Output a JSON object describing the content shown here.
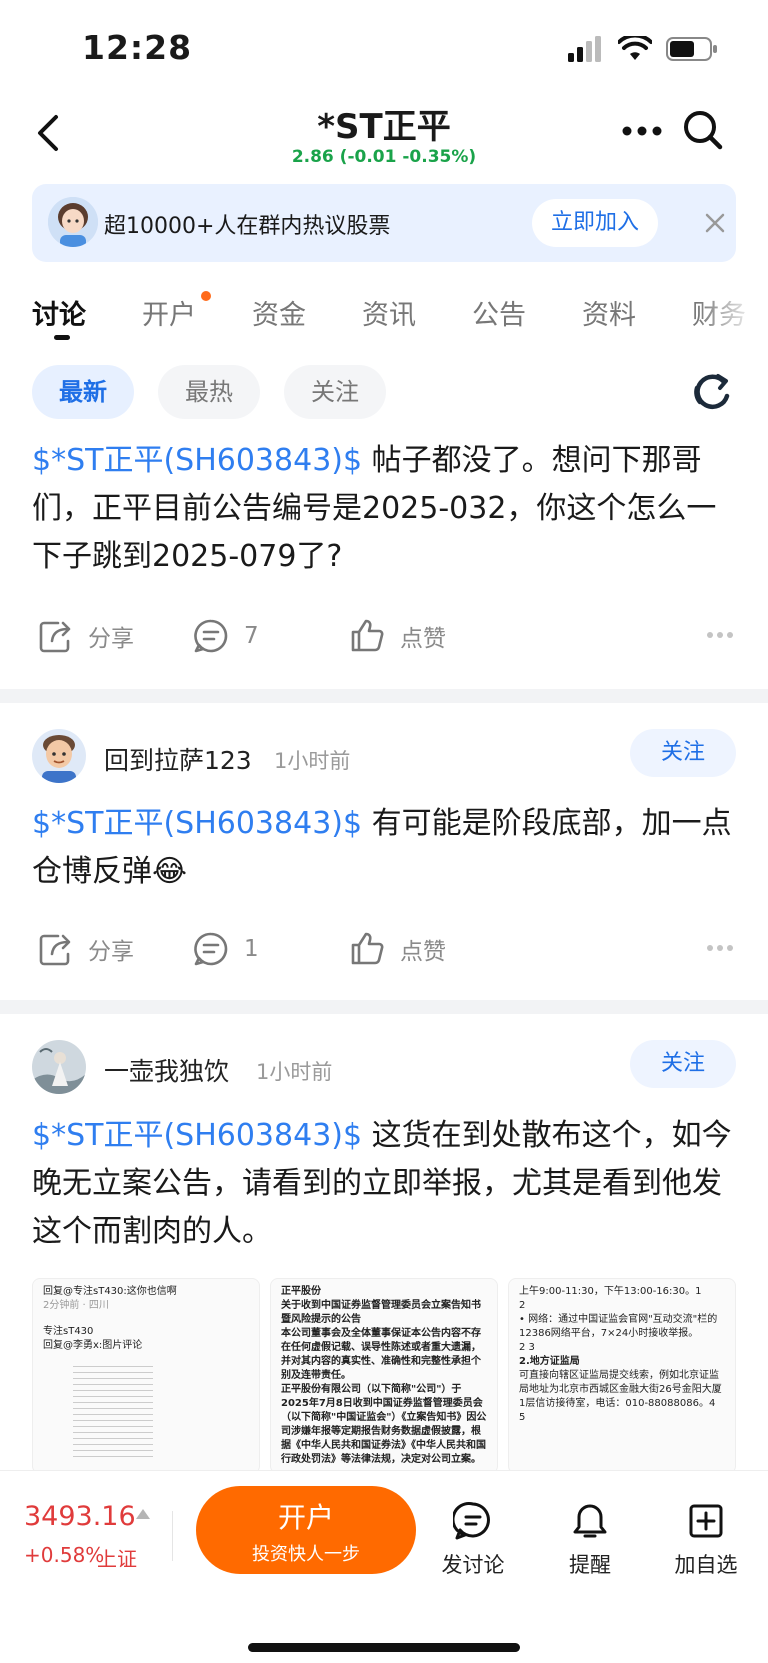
{
  "status": {
    "time": "12:28"
  },
  "header": {
    "title": "*ST正平",
    "quote": "2.86 (-0.01 -0.35%)"
  },
  "banner": {
    "text": "超10000+人在群内热议股票",
    "join_label": "立即加入"
  },
  "tabs": [
    "讨论",
    "开户",
    "资金",
    "资讯",
    "公告",
    "资料",
    "财务"
  ],
  "filters": [
    "最新",
    "最热",
    "关注"
  ],
  "posts": [
    {
      "ticker": "$*ST正平(SH603843)$",
      "body": " 帖子都没了。想问下那哥们，正平目前公告编号是2025-032，你这个怎么一下子跳到2025-079了?",
      "share_label": "分享",
      "comments": "7",
      "like_label": "点赞"
    },
    {
      "username": "回到拉萨123",
      "time": "1小时前",
      "follow_label": "关注",
      "ticker": "$*ST正平(SH603843)$",
      "body": " 有可能是阶段底部，加一点仓博反弹",
      "emoji": "😂",
      "share_label": "分享",
      "comments": "1",
      "like_label": "点赞"
    },
    {
      "username": "一壶我独饮",
      "time": "1小时前",
      "follow_label": "关注",
      "ticker": "$*ST正平(SH603843)$",
      "body": " 这货在到处散布这个，如今晚无立案公告，请看到的立即举报，尤其是看到他发这个而割肉的人。",
      "images": [
        {
          "lines": [
            "回复@专注sT430:这你也信啊",
            "2分钟前 · 四川",
            "专注sT430",
            "回复@李勇x:图片评论"
          ]
        },
        {
          "lines": [
            "正平股份",
            "关于收到中国证券监督管理委员会立案告知书暨风险提示的公告",
            "本公司董事会及全体董事保证本公告内容不存在任何虚假记载、误导性陈述或者重大遗漏，并对其内容的真实性、准确性和完整性承担个别及连带责任。",
            "正平股份有限公司（以下简称\"公司\"）于2025年7月8日收到中国证券监督管理委员会（以下简称\"中国证监会\"）《立案告知书》因公司涉嫌年报等定期报告财务数据虚假披露，根据《中华人民共和国证券法》《中华人民共和国行政处罚法》等法律法规，决定对公司立案。"
          ]
        },
        {
          "lines": [
            "上午9:00-11:30，下午13:00-16:30。1",
            "2",
            "• 网络：通过中国证监会官网\"互动交流\"栏的12386网络平台，7×24小时接收举报。",
            "2 3",
            "2.地方证监局",
            "可直接向辖区证监局提交线索，例如北京证监局地址为北京市西城区金融大街26号金阳大厦1层信访接待室，电话：010-88088086。4",
            "5"
          ]
        }
      ]
    }
  ],
  "bottom": {
    "index_value": "3493.16",
    "index_change": "+0.58%",
    "index_name": "上证",
    "open_label": "开户",
    "open_sub": "投资快人一步",
    "discuss_label": "发讨论",
    "remind_label": "提醒",
    "watch_label": "加自选"
  }
}
